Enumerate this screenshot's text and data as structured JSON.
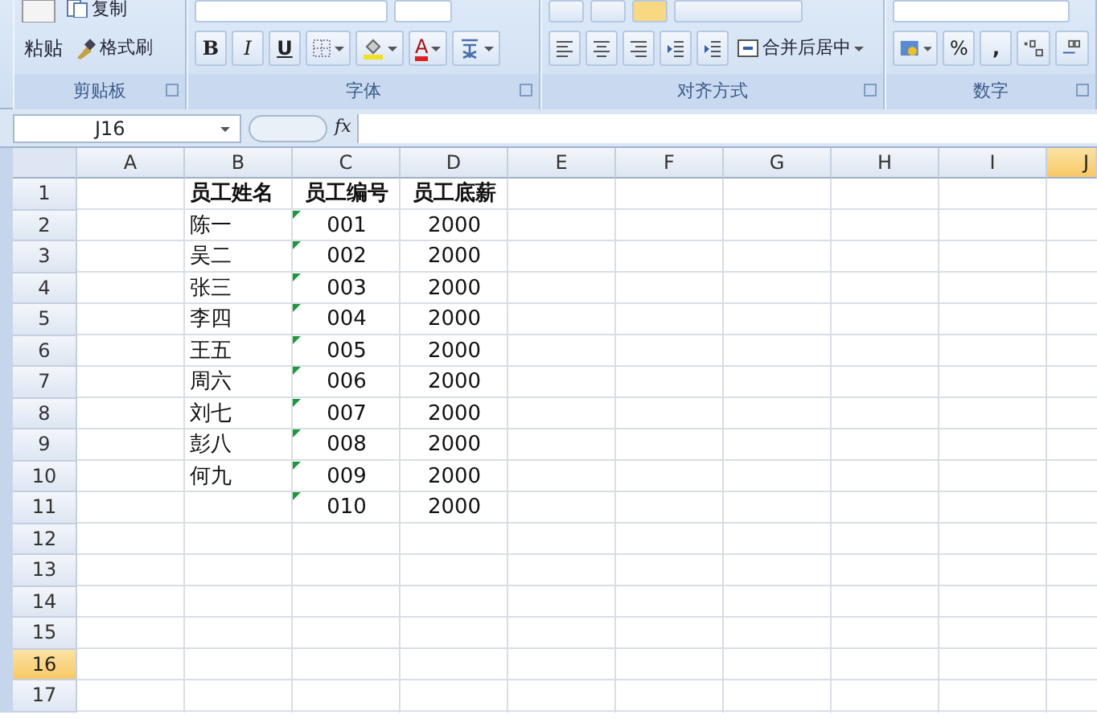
{
  "ribbon": {
    "clipboard": {
      "paste_label": "粘贴",
      "copy_label": "复制",
      "format_painter_label": "格式刷",
      "group_label": "剪贴板"
    },
    "font": {
      "bold": "B",
      "italic": "I",
      "underline": "U",
      "font_color_letter": "A",
      "group_label": "字体"
    },
    "alignment": {
      "merge_label": "合并后居中",
      "group_label": "对齐方式"
    },
    "number": {
      "percent": "%",
      "comma": ",",
      "group_label": "数字"
    }
  },
  "formula_bar": {
    "name_box": "J16",
    "fx": "fx"
  },
  "sheet": {
    "columns": [
      {
        "label": "A",
        "selected": false
      },
      {
        "label": "B",
        "selected": false
      },
      {
        "label": "C",
        "selected": false
      },
      {
        "label": "D",
        "selected": false
      },
      {
        "label": "E",
        "selected": false
      },
      {
        "label": "F",
        "selected": false
      },
      {
        "label": "G",
        "selected": false
      },
      {
        "label": "H",
        "selected": false
      },
      {
        "label": "I",
        "selected": false
      },
      {
        "label": "J",
        "selected": true
      }
    ],
    "rows": [
      {
        "number": "1",
        "selected": false,
        "kind": "header",
        "text_flag": false,
        "cells": [
          "",
          "员工姓名",
          "员工编号",
          "员工底薪"
        ]
      },
      {
        "number": "2",
        "selected": false,
        "kind": "data",
        "text_flag": true,
        "cells": [
          "",
          "陈一",
          "001",
          "2000"
        ]
      },
      {
        "number": "3",
        "selected": false,
        "kind": "data",
        "text_flag": true,
        "cells": [
          "",
          "吴二",
          "002",
          "2000"
        ]
      },
      {
        "number": "4",
        "selected": false,
        "kind": "data",
        "text_flag": true,
        "cells": [
          "",
          "张三",
          "003",
          "2000"
        ]
      },
      {
        "number": "5",
        "selected": false,
        "kind": "data",
        "text_flag": true,
        "cells": [
          "",
          "李四",
          "004",
          "2000"
        ]
      },
      {
        "number": "6",
        "selected": false,
        "kind": "data",
        "text_flag": true,
        "cells": [
          "",
          "王五",
          "005",
          "2000"
        ]
      },
      {
        "number": "7",
        "selected": false,
        "kind": "data",
        "text_flag": true,
        "cells": [
          "",
          "周六",
          "006",
          "2000"
        ]
      },
      {
        "number": "8",
        "selected": false,
        "kind": "data",
        "text_flag": true,
        "cells": [
          "",
          "刘七",
          "007",
          "2000"
        ]
      },
      {
        "number": "9",
        "selected": false,
        "kind": "data",
        "text_flag": true,
        "cells": [
          "",
          "彭八",
          "008",
          "2000"
        ]
      },
      {
        "number": "10",
        "selected": false,
        "kind": "data",
        "text_flag": true,
        "cells": [
          "",
          "何九",
          "009",
          "2000"
        ]
      },
      {
        "number": "11",
        "selected": false,
        "kind": "data",
        "text_flag": true,
        "cells": [
          "",
          "",
          "010",
          "2000"
        ]
      },
      {
        "number": "12",
        "selected": false,
        "text_flag": false,
        "cells": []
      },
      {
        "number": "13",
        "selected": false,
        "text_flag": false,
        "cells": []
      },
      {
        "number": "14",
        "selected": false,
        "text_flag": false,
        "cells": []
      },
      {
        "number": "15",
        "selected": false,
        "text_flag": false,
        "cells": []
      },
      {
        "number": "16",
        "selected": true,
        "text_flag": false,
        "cells": []
      },
      {
        "number": "17",
        "selected": false,
        "text_flag": false,
        "cells": []
      }
    ]
  }
}
